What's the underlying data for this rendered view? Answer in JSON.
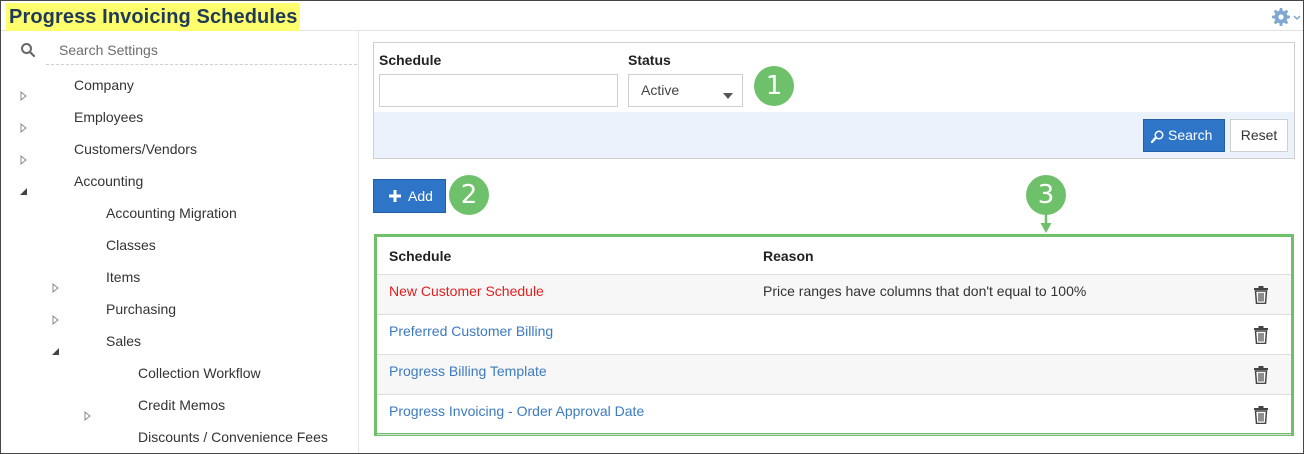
{
  "header": {
    "title": "Progress Invoicing Schedules",
    "highlight_color": "#ffff6e"
  },
  "sidebar": {
    "search_placeholder": "Search Settings",
    "items": [
      {
        "label": "Company",
        "level": 0,
        "state": "collapsed"
      },
      {
        "label": "Employees",
        "level": 0,
        "state": "collapsed"
      },
      {
        "label": "Customers/Vendors",
        "level": 0,
        "state": "collapsed"
      },
      {
        "label": "Accounting",
        "level": 0,
        "state": "expanded"
      },
      {
        "label": "Accounting Migration",
        "level": 1,
        "state": "leaf"
      },
      {
        "label": "Classes",
        "level": 1,
        "state": "leaf"
      },
      {
        "label": "Items",
        "level": 1,
        "state": "collapsed"
      },
      {
        "label": "Purchasing",
        "level": 1,
        "state": "collapsed"
      },
      {
        "label": "Sales",
        "level": 1,
        "state": "expanded"
      },
      {
        "label": "Collection Workflow",
        "level": 2,
        "state": "leaf"
      },
      {
        "label": "Credit Memos",
        "level": 2,
        "state": "collapsed"
      },
      {
        "label": "Discounts / Convenience Fees",
        "level": 2,
        "state": "leaf"
      }
    ]
  },
  "filter": {
    "schedule_label": "Schedule",
    "schedule_value": "",
    "status_label": "Status",
    "status_value": "Active",
    "search_label": "Search",
    "reset_label": "Reset"
  },
  "actions": {
    "add_label": "Add"
  },
  "callouts": {
    "one": "1",
    "two": "2",
    "three": "3",
    "color": "#6ec16a"
  },
  "table": {
    "columns": [
      "Schedule",
      "Reason"
    ],
    "rows": [
      {
        "schedule": "New Customer Schedule",
        "reason": "Price ranges have columns that don't equal to 100%",
        "error": true
      },
      {
        "schedule": "Preferred Customer Billing",
        "reason": "",
        "error": false
      },
      {
        "schedule": "Progress Billing Template",
        "reason": "",
        "error": false
      },
      {
        "schedule": "Progress Invoicing - Order Approval Date",
        "reason": "",
        "error": false
      }
    ]
  },
  "colors": {
    "primary": "#2e75c8",
    "link": "#3d7ac0",
    "error": "#e02020",
    "filter_footer": "#ecf2fb"
  }
}
